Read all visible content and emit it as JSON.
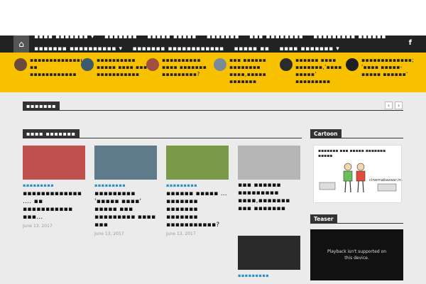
{
  "nav": {
    "row1": [
      "▪▪▪▪ ▪▪▪▪▪▪▪ ▾",
      "▪▪▪▪▪▪▪",
      "▪▪▪▪▪ ▪▪▪▪▪",
      "▪▪▪▪▪▪▪",
      "▪▪▪ ▪▪▪▪▪▪▪▪",
      "▪▪▪▪▪▪▪▪▪ ▪▪▪▪▪▪"
    ],
    "row2": [
      "▪▪▪▪▪▪▪ ▪▪▪▪▪▪▪▪▪▪ ▾",
      "▪▪▪▪▪▪▪ ▪▪▪▪▪▪▪▪▪▪▪▪",
      "▪▪▪▪▪ ▪▪",
      "▪▪▪▪ ▪▪▪▪▪▪▪ ▾"
    ],
    "facebook": "f",
    "home_icon": "⌂"
  },
  "ticker": [
    {
      "text": "▪▪▪▪▪▪▪▪▪▪▪▪▪▪… ▪▪ ▪▪▪▪▪▪▪▪▪▪▪▪",
      "color": "#6b4c3b"
    },
    {
      "text": "▪▪▪▪▪▪▪▪▪▪ ▪▪▪▪▪ ▪▪▪▪ ▪▪▪ ▪▪▪▪▪▪▪▪▪▪▪",
      "color": "#3d5a6c"
    },
    {
      "text": "▪▪▪▪▪▪▪▪▪▪ ▪▪▪▪ ▪▪▪▪▪▪▪ ▪▪▪▪▪▪▪▪▪?",
      "color": "#a05040"
    },
    {
      "text": "▪▪▪ ▪▪▪▪▪▪ ▪▪▪▪▪▪▪▪ ▪▪▪▪,▪▪▪▪▪ ▪▪▪▪▪▪▪",
      "color": "#7b8a95"
    },
    {
      "text": "▪▪▪▪▪▪ ▪▪▪▪ ▪▪▪▪▪▪▪,'▪▪▪▪ ▪▪▪▪▪' ▪▪▪▪▪▪▪▪▪",
      "color": "#2b2b2b"
    },
    {
      "text": "▪▪▪▪▪▪▪▪▪▪▪▪▪; '▪▪▪▪ ▪▪▪▪▪- ▪▪▪▪▪ ▪▪▪▪▪▪'",
      "color": "#1f1f1f"
    }
  ],
  "pager": {
    "prev": "‹",
    "next": "›"
  },
  "sections": {
    "top_label": "▪▪▪▪▪▪▪",
    "news_label": "▪▪▪▪ ▪▪▪▪▪▪▪"
  },
  "cards": [
    {
      "category": "▪▪▪▪▪▪▪▪▪",
      "title": "▪▪▪▪▪▪▪▪▪▪▪▪▪ …. ▪▪ ▪▪▪▪▪▪▪▪▪▪▪ ▪▪▪…",
      "date": "June 13, 2017",
      "color": "#c0504d"
    },
    {
      "category": "▪▪▪▪▪▪▪▪▪",
      "title": "▪▪▪▪▪▪▪▪▪ '▪▪▪▪▪ ▪▪▪▪' ▪▪▪▪▪ ▪▪▪ ▪▪▪▪▪▪▪▪▪ ▪▪▪▪ ▪▪▪",
      "date": "June 13, 2017",
      "color": "#5d7b8a"
    },
    {
      "category": "▪▪▪▪▪▪▪▪▪",
      "title": "▪▪▪▪▪▪ ▪▪▪▪▪ … ▪▪▪▪▪▪▪ ▪▪▪▪▪▪▪ ▪▪▪▪▪▪▪ ▪▪▪▪▪▪▪▪▪▪▪?",
      "date": "June 13, 2017",
      "color": "#7a9a4a"
    },
    {
      "category": "",
      "title": "▪▪▪ ▪▪▪▪▪▪ ▪▪▪▪▪▪▪▪▪ ▪▪▪▪,▪▪▪▪▪▪▪ ▪▪▪ ▪▪▪▪▪▪▪",
      "date": "",
      "color": "#b5b5b5"
    },
    {
      "category": "▪▪▪▪▪▪▪▪▪",
      "title": "",
      "date": "",
      "color": "#2a2a2a"
    }
  ],
  "sidebar": {
    "cartoon_label": "Cartoon",
    "cartoon_handwriting": "▪▪▪▪▪▪▪ ▪▪▪ ▪▪▪▪▪ ▪▪▪▪▪▪▪ ▪▪▪▪▪",
    "cartoon_site": "cinemabazaar.in",
    "teaser_label": "Teaser",
    "video_message": "Playback isn't supported on this device."
  }
}
